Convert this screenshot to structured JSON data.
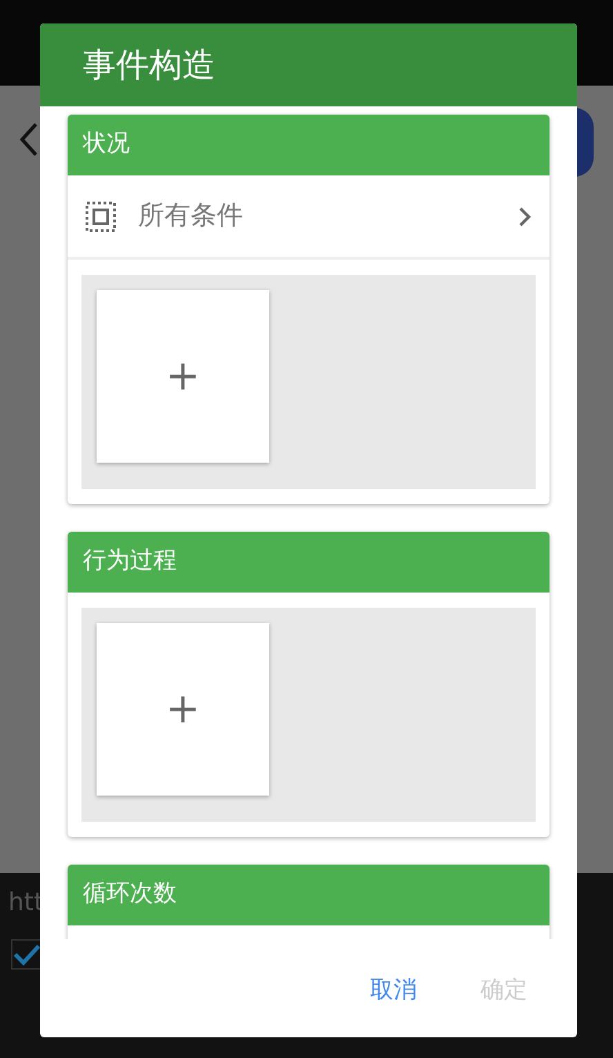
{
  "background": {
    "link_text": "htt",
    "checkbox": {
      "checked": true
    }
  },
  "dialog": {
    "title": "事件构造",
    "sections": [
      {
        "title": "状况",
        "row": {
          "label": "所有条件"
        },
        "add_tile": "+"
      },
      {
        "title": "行为过程",
        "add_tile": "+"
      },
      {
        "title": "循环次数"
      }
    ],
    "buttons": [
      {
        "label": "取消",
        "disabled": false
      },
      {
        "label": "确定",
        "disabled": true
      }
    ]
  }
}
